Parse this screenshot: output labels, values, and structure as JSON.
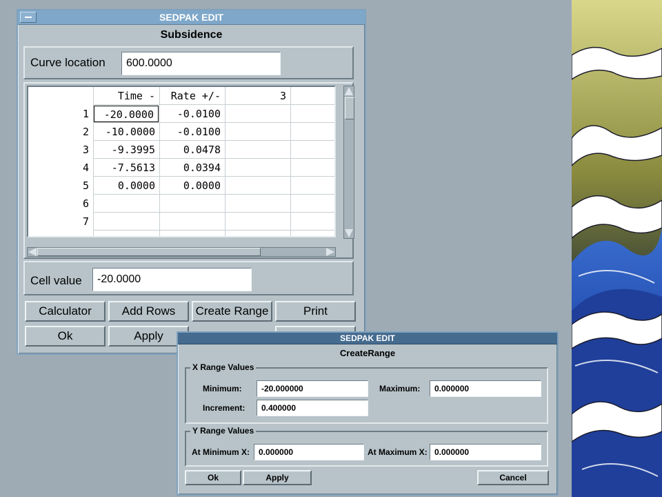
{
  "main_window": {
    "title": "SEDPAK EDIT",
    "heading": "Subsidence",
    "curve_location_label": "Curve location",
    "curve_location_value": "600.0000",
    "table": {
      "headers": [
        "Time -",
        "Rate +/-",
        "3"
      ],
      "rows": [
        {
          "num": "1",
          "time": "-20.0000",
          "rate": "-0.0100"
        },
        {
          "num": "2",
          "time": "-10.0000",
          "rate": "-0.0100"
        },
        {
          "num": "3",
          "time": "-9.3995",
          "rate": "0.0478"
        },
        {
          "num": "4",
          "time": "-7.5613",
          "rate": "0.0394"
        },
        {
          "num": "5",
          "time": "0.0000",
          "rate": "0.0000"
        },
        {
          "num": "6",
          "time": "",
          "rate": ""
        },
        {
          "num": "7",
          "time": "",
          "rate": ""
        }
      ]
    },
    "cell_value_label": "Cell value",
    "cell_value": "-20.0000",
    "buttons": {
      "calculator": "Calculator",
      "add_rows": "Add Rows",
      "create_range": "Create Range",
      "print": "Print",
      "ok": "Ok",
      "apply": "Apply",
      "cancel": "Cancel"
    }
  },
  "range_dialog": {
    "title": "SEDPAK EDIT",
    "heading": "CreateRange",
    "x_group_label": "X Range Values",
    "minimum_label": "Minimum:",
    "minimum_value": "-20.000000",
    "maximum_label": "Maximum:",
    "maximum_value": "0.000000",
    "increment_label": "Increment:",
    "increment_value": "0.400000",
    "y_group_label": "Y Range Values",
    "at_min_x_label": "At Minimum X:",
    "at_min_x_value": "0.000000",
    "at_max_x_label": "At Maximum X:",
    "at_max_x_value": "0.000000",
    "buttons": {
      "ok": "Ok",
      "apply": "Apply",
      "cancel": "Cancel"
    }
  },
  "colors": {
    "desktop": "#9eabb5",
    "window_bg": "#b7c3c9",
    "titlebar": "#7ea7c9"
  }
}
